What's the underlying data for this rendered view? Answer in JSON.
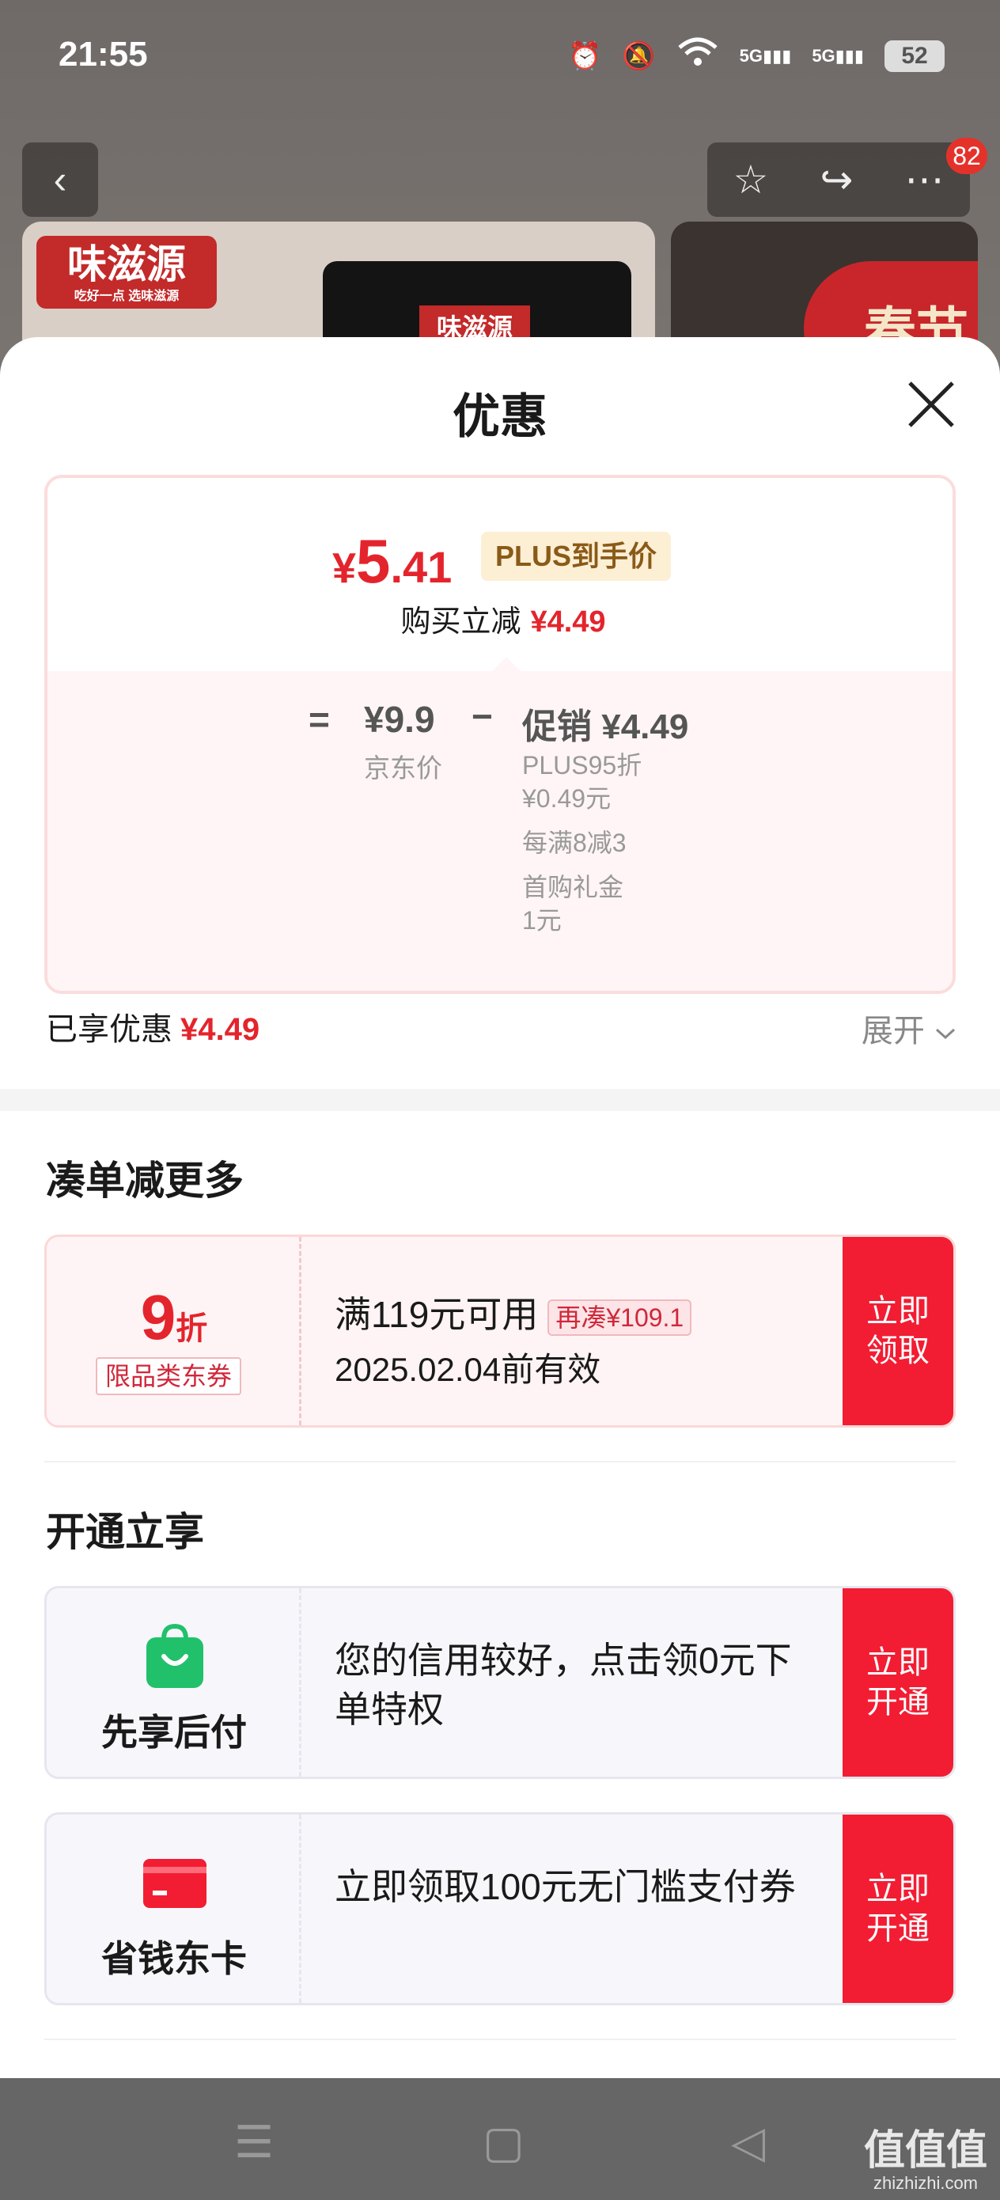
{
  "status_bar": {
    "time": "21:55",
    "signal1": "5G",
    "signal2": "5G",
    "battery": "52"
  },
  "top_nav": {
    "notification_count": "82"
  },
  "product_preview": {
    "brand_logo": "味滋源",
    "brand_slogan": "吃好一点 选味滋源",
    "package_logo": "味滋源",
    "banner_text": "春节"
  },
  "sheet": {
    "title": "优惠",
    "price_summary": {
      "currency": "¥",
      "final_int": "5",
      "final_dec": ".41",
      "plus_tag": "PLUS到手价",
      "reduce_label": "购买立减",
      "reduce_amount": "¥4.49"
    },
    "breakdown": {
      "equals": "=",
      "jd_price": "¥9.9",
      "jd_price_label": "京东价",
      "minus": "−",
      "promo_label": "促销 ¥4.49",
      "promo_items": [
        "PLUS95折\n¥0.49元",
        "每满8减3",
        "首购礼金\n1元"
      ]
    },
    "enjoyed": {
      "label": "已享优惠",
      "amount": "¥4.49",
      "expand": "展开"
    },
    "section_more": {
      "title": "凑单减更多",
      "coupon": {
        "discount_num": "9",
        "discount_unit": "折",
        "type_tag": "限品类东券",
        "condition": "满119元可用",
        "more_badge": "再凑¥109.1",
        "expiry": "2025.02.04前有效",
        "button": "立即\n领取"
      }
    },
    "section_open": {
      "title": "开通立享",
      "items": [
        {
          "name": "先享后付",
          "desc": "您的信用较好，点击领0元下单特权",
          "button": "立即\n开通",
          "icon": "shopping-bag-icon",
          "color": "#21c16b"
        },
        {
          "name": "省钱东卡",
          "desc": "立即领取100元无门槛支付券",
          "button": "立即\n开通",
          "icon": "card-icon",
          "color": "#f21d33"
        }
      ]
    }
  },
  "watermark": {
    "text": "值值值",
    "site": "zhizhizhi.com"
  }
}
